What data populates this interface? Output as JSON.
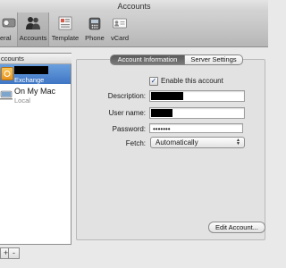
{
  "window": {
    "title": "Accounts"
  },
  "toolbar": {
    "items": [
      {
        "label": "eral",
        "icon": "general-switch-icon"
      },
      {
        "label": "Accounts",
        "icon": "accounts-people-icon",
        "selected": true
      },
      {
        "label": "Template",
        "icon": "template-icon"
      },
      {
        "label": "Phone",
        "icon": "phone-icon"
      },
      {
        "label": "vCard",
        "icon": "vcard-icon"
      }
    ]
  },
  "sidebar": {
    "header": "ccounts",
    "accounts": [
      {
        "name": "",
        "type": "Exchange",
        "selected": true,
        "name_redacted": true
      },
      {
        "name": "On My Mac",
        "type": "Local"
      }
    ]
  },
  "bottom_buttons": {
    "add": "+",
    "remove": "-"
  },
  "tabs": [
    {
      "label": "Account Information",
      "selected": true
    },
    {
      "label": "Server Settings",
      "selected": false
    }
  ],
  "form": {
    "enable_label": "Enable this account",
    "enable_checked": true,
    "description_label": "Description:",
    "username_label": "User name:",
    "password_label": "Password:",
    "password_value": "•••••••",
    "fetch_label": "Fetch:",
    "fetch_value": "Automatically"
  },
  "edit_button": "Edit Account..."
}
